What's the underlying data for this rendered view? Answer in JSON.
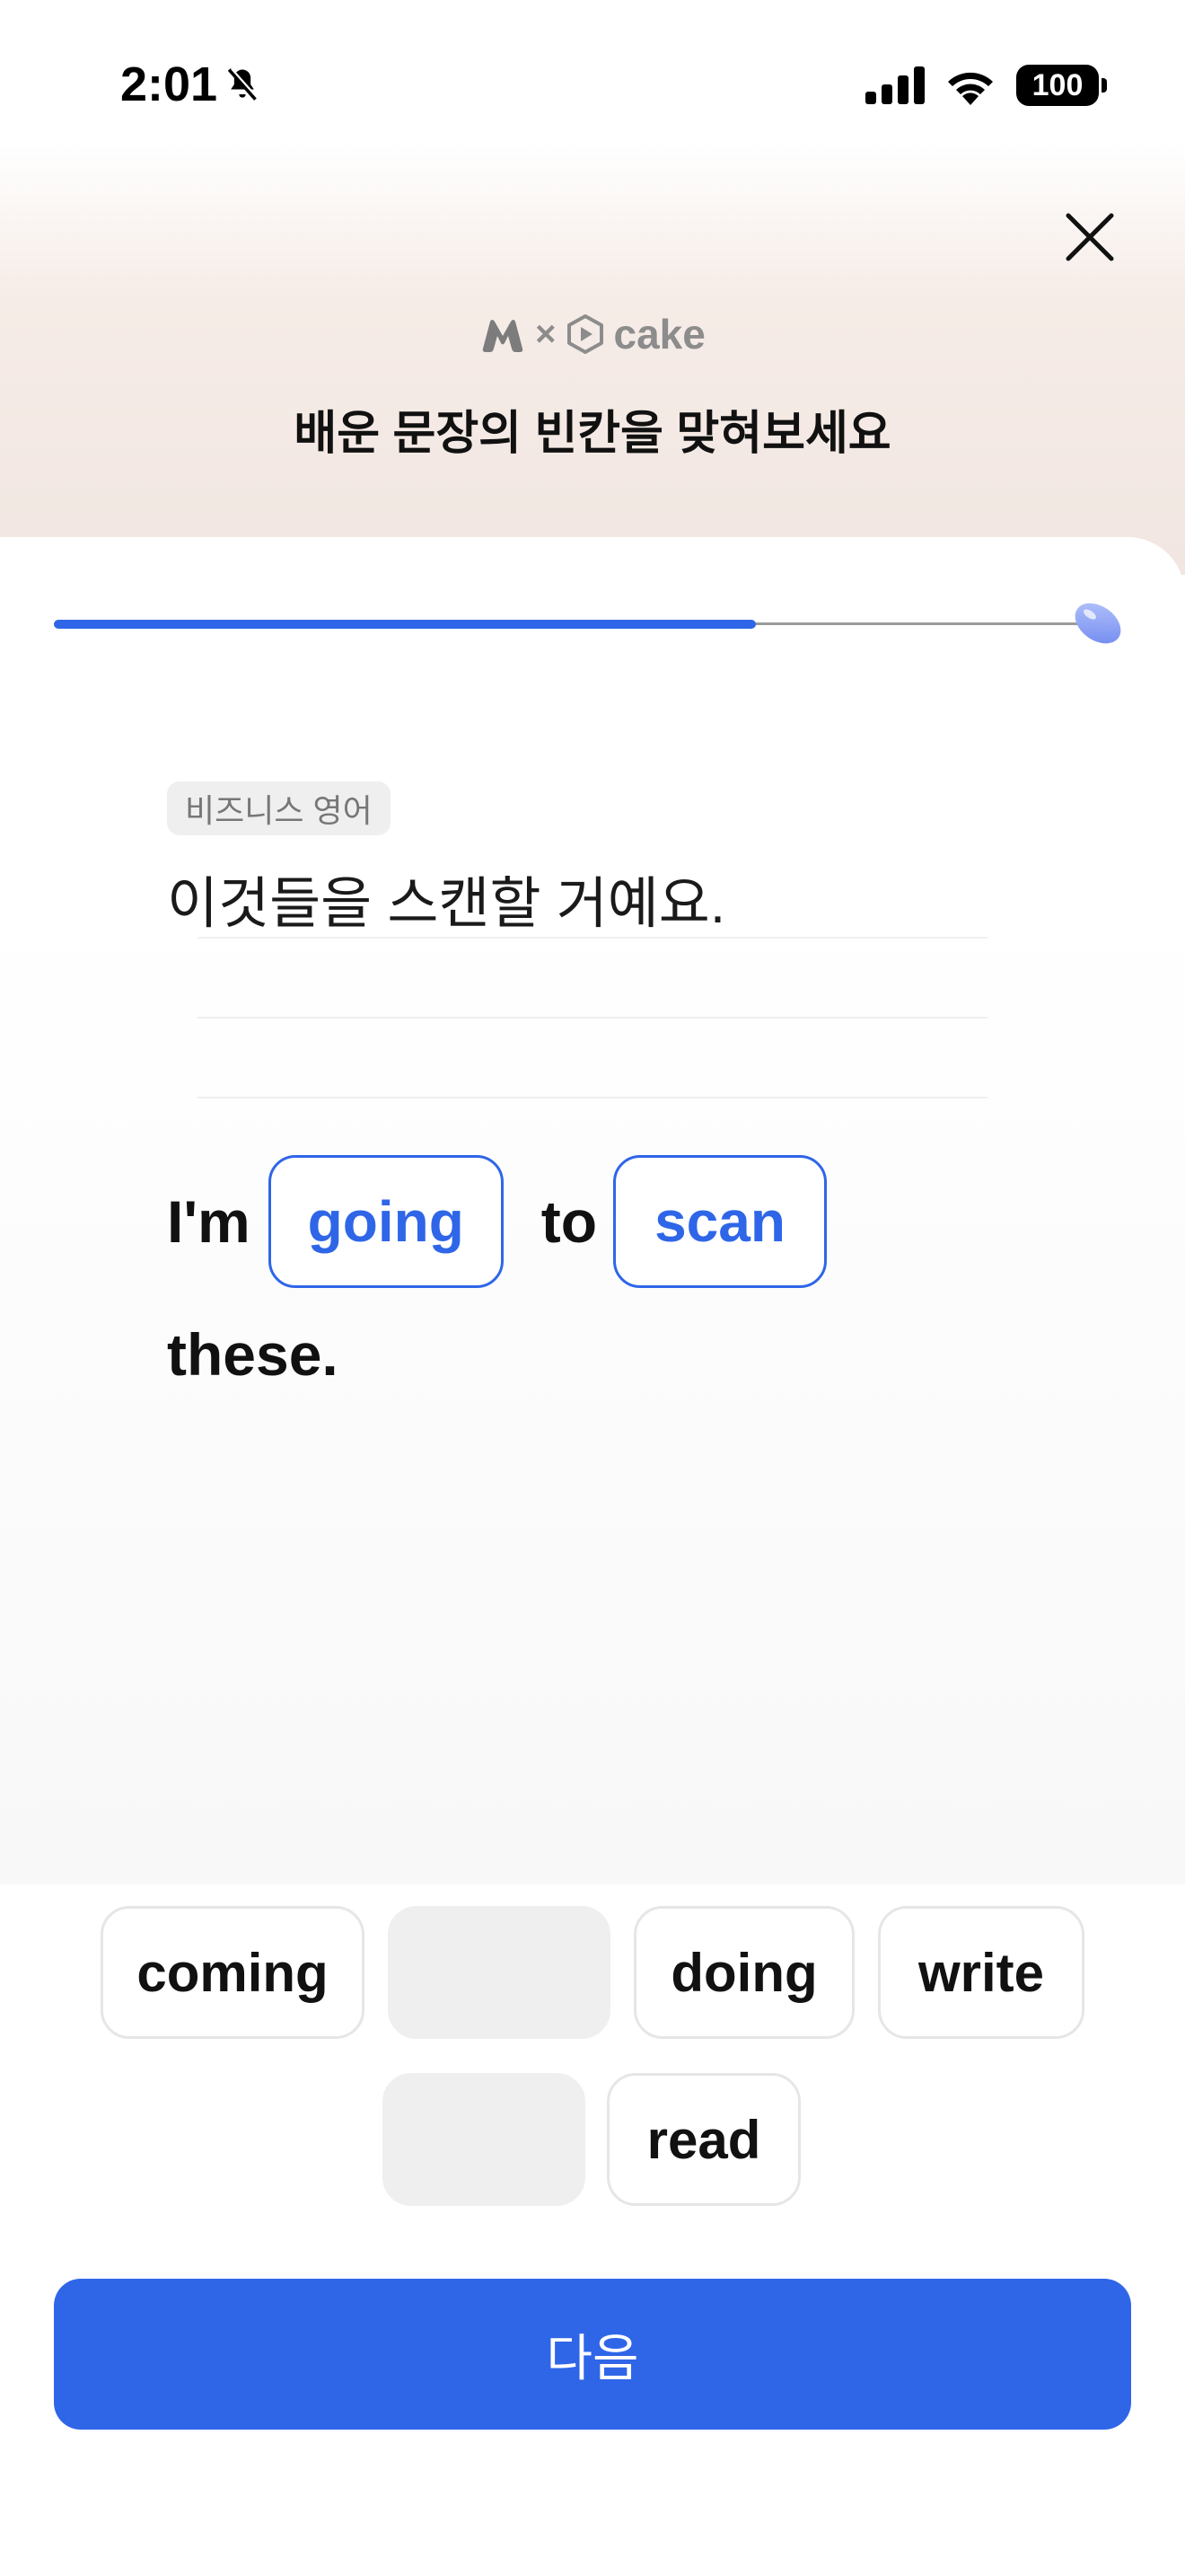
{
  "status_bar": {
    "time": "2:01",
    "battery": "100"
  },
  "header": {
    "brand_text": "cake",
    "brand_separator": "×",
    "title": "배운 문장의 빈칸을 맞혀보세요"
  },
  "progress": {
    "value": 0.68,
    "fill_color": "#2f66e8"
  },
  "question": {
    "category": "비즈니스 영어",
    "korean": "이것들을 스캔할 거예요.",
    "sentence": {
      "word_1": "I'm",
      "blank_1": "going",
      "word_2": "to",
      "blank_2": "scan",
      "word_3": "these."
    }
  },
  "choices": {
    "row1": [
      "coming",
      "",
      "doing",
      "write"
    ],
    "row2": [
      "",
      "read"
    ]
  },
  "actions": {
    "next_label": "다음"
  },
  "colors": {
    "accent": "#2f66e8",
    "chip_border": "#e6e6e6",
    "empty_chip": "#efefef"
  }
}
